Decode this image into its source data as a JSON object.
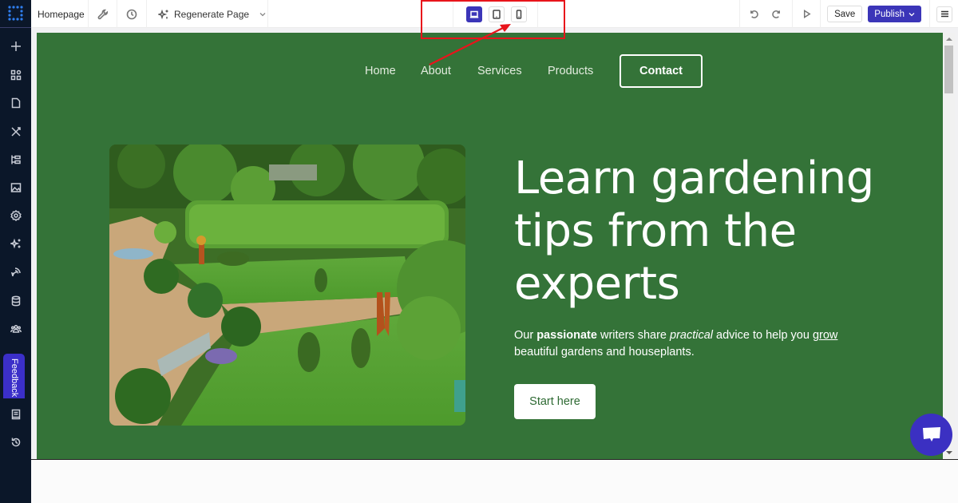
{
  "topbar": {
    "page_name": "Homepage",
    "tools": [
      {
        "icon": "wrench-icon"
      },
      {
        "icon": "history-clock-icon"
      }
    ],
    "regenerate_label": "Regenerate Page",
    "devices": [
      {
        "name": "desktop",
        "icon": "laptop-icon",
        "active": true
      },
      {
        "name": "tablet",
        "icon": "tablet-icon",
        "active": false
      },
      {
        "name": "mobile",
        "icon": "mobile-icon",
        "active": false
      }
    ],
    "undo_icon": "undo-icon",
    "redo_icon": "redo-icon",
    "preview_icon": "play-icon",
    "save_label": "Save",
    "publish_label": "Publish",
    "menu_icon": "hamburger-icon"
  },
  "sidebar": {
    "items": [
      {
        "icon": "plus-icon"
      },
      {
        "icon": "blocks-icon"
      },
      {
        "icon": "page-icon"
      },
      {
        "icon": "design-tools-icon"
      },
      {
        "icon": "sitemap-icon"
      },
      {
        "icon": "image-icon"
      },
      {
        "icon": "settings-gear-icon"
      },
      {
        "icon": "ai-sparkle-icon"
      },
      {
        "icon": "integrations-icon"
      },
      {
        "icon": "database-icon"
      },
      {
        "icon": "users-icon"
      },
      {
        "icon": "docs-book-icon"
      },
      {
        "icon": "history-icon"
      }
    ],
    "feedback_label": "Feedback"
  },
  "site": {
    "nav": [
      "Home",
      "About",
      "Services",
      "Products"
    ],
    "contact_label": "Contact",
    "hero": {
      "title": "Learn gardening tips from the experts",
      "desc_parts": {
        "p1": "Our ",
        "bold": "passionate",
        "p2": " writers share ",
        "italic": "practical",
        "p3": " advice to help you ",
        "underline": "grow",
        "p4": " beautiful gardens and houseplants."
      },
      "cta_label": "Start here",
      "image_alt": "Garden with topiary animals, hedges and lawn"
    },
    "colors": {
      "background": "#347338",
      "accent": "#3b35b8"
    }
  },
  "annotation": {
    "highlight": "device switcher",
    "color": "#e8141b"
  }
}
